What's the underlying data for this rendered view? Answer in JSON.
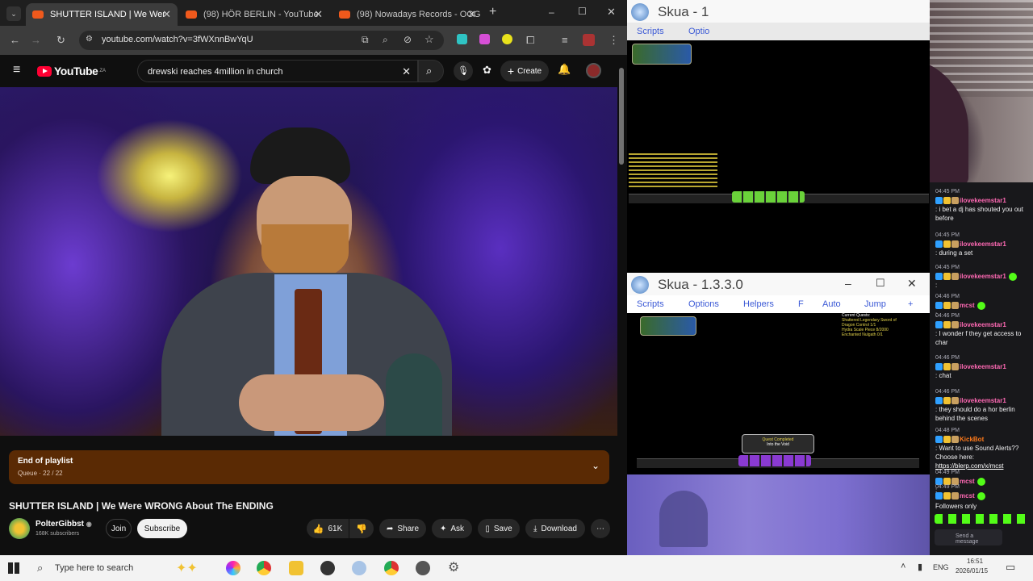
{
  "browser": {
    "tabs": [
      {
        "label": "SHUTTER ISLAND | We Wer",
        "active": true
      },
      {
        "label": "(98) HÖR BERLIN - YouTube",
        "active": false
      },
      {
        "label": "(98) Nowadays Records - OOG",
        "active": false
      }
    ],
    "new_tab": "+",
    "url": "youtube.com/watch?v=3fWXnnBwYqU",
    "window": {
      "minimize": "–",
      "maximize": "☐",
      "close": "✕"
    }
  },
  "youtube": {
    "logo": "YouTube",
    "logo_sup": "ZA",
    "search_value": "drewski reaches 4million in church",
    "create_label": "Create",
    "playlist": {
      "title": "End of playlist",
      "subtitle": "Queue · 22 / 22"
    },
    "video_title": "SHUTTER ISLAND | We Were WRONG About The ENDING",
    "channel": {
      "name": "PolterGibbst",
      "subscribers": "168K subscribers"
    },
    "join_label": "Join",
    "subscribe_label": "Subscribe",
    "likes": "61K",
    "share_label": "Share",
    "ask_label": "Ask",
    "save_label": "Save",
    "download_label": "Download"
  },
  "skua": {
    "window1_title": "Skua - 1",
    "window1_menu": [
      "Scripts",
      "Optio"
    ],
    "window2_title": "Skua - 1.3.3.0",
    "window2_menu": [
      "Scripts",
      "Options",
      "Helpers",
      "F",
      "Auto",
      "Jump",
      "+"
    ],
    "quest_text": "Current Quests:",
    "quest_popup": "Quest Completed",
    "quest_item": "Into the Void",
    "quest_lines": [
      "Shattered Legendary Sword of",
      "Dragon Control 1/1",
      "Hydra Scale Piece 8/2000",
      "Enchanted Nulgath 0/1"
    ]
  },
  "chat": {
    "messages": [
      {
        "time": "04:45 PM",
        "user": "ilovekeemstar1",
        "text": ": i bet a dj has shouted you out before"
      },
      {
        "time": "04:45 PM",
        "user": "ilovekeemstar1",
        "text": ": during a set"
      },
      {
        "time": "04:45 PM",
        "user": "ilovekeemstar1",
        "text": ":"
      },
      {
        "time": "04:46 PM",
        "user": "mcst",
        "text": ":"
      },
      {
        "time": "04:46 PM",
        "user": "ilovekeemstar1",
        "text": ": I wonder f they get access to char"
      },
      {
        "time": "04:46 PM",
        "user": "ilovekeemstar1",
        "text": ": chat"
      },
      {
        "time": "04:46 PM",
        "user": "ilovekeemstar1",
        "text": ": they should do a hor berlin behind the scenes"
      },
      {
        "time": "04:48 PM",
        "user": "KickBot",
        "text": ": Want to use Sound Alerts?? Choose here:",
        "link": "https://blerp.com/x/mcst"
      },
      {
        "time": "04:49 PM",
        "user": "mcst",
        "text": ":"
      },
      {
        "time": "04:49 PM",
        "user": "mcst",
        "text": ":"
      }
    ],
    "followers_only": "Followers only",
    "send_placeholder": "Send a message"
  },
  "taskbar": {
    "search_placeholder": "Type here to search",
    "language": "ENG",
    "time": "16:51",
    "date": "2026/01/15"
  },
  "colors": {
    "youtube_red": "#ff0033",
    "chat_bg": "#18181b",
    "playlist_bg": "#5a2a04",
    "user_pink": "#ff69b4",
    "kickbot_orange": "#ff7a1a",
    "user_green": "#53fc18"
  }
}
